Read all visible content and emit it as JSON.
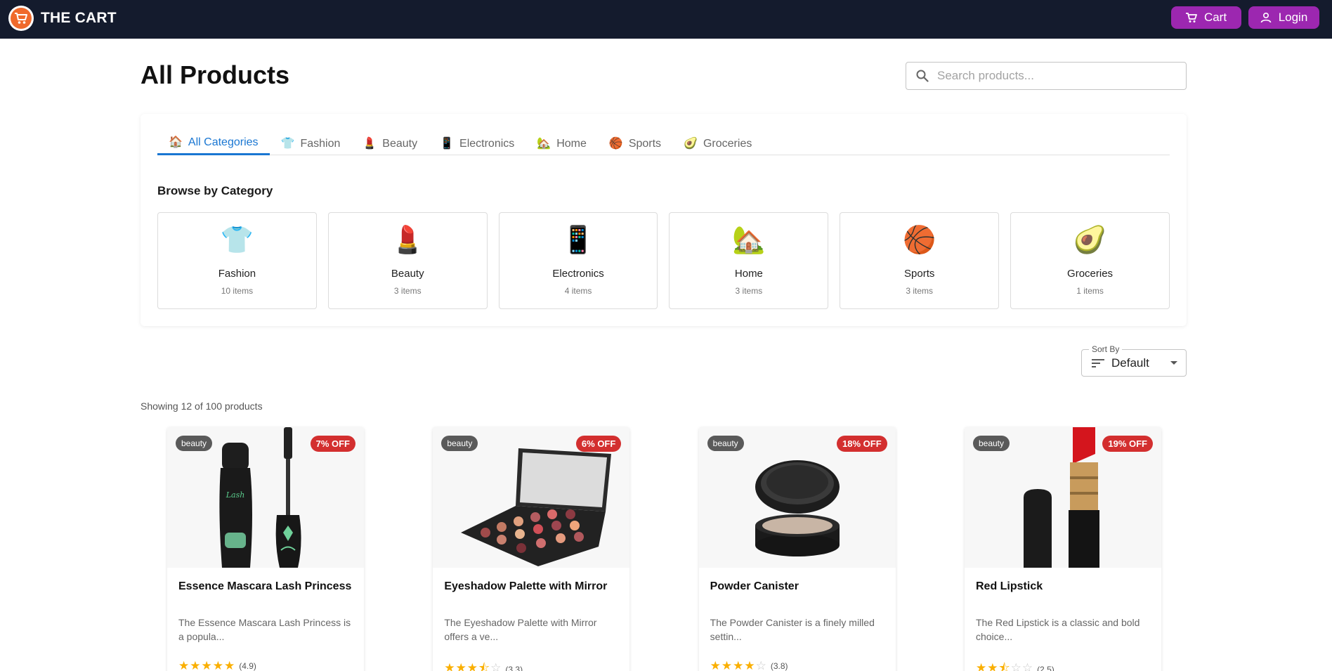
{
  "header": {
    "brand": "THE CART",
    "cart_label": "Cart",
    "login_label": "Login"
  },
  "page": {
    "title": "All Products",
    "search_placeholder": "Search products..."
  },
  "tabs": [
    {
      "icon": "🏠",
      "label": "All Categories"
    },
    {
      "icon": "👕",
      "label": "Fashion"
    },
    {
      "icon": "💄",
      "label": "Beauty"
    },
    {
      "icon": "📱",
      "label": "Electronics"
    },
    {
      "icon": "🏡",
      "label": "Home"
    },
    {
      "icon": "🏀",
      "label": "Sports"
    },
    {
      "icon": "🥑",
      "label": "Groceries"
    }
  ],
  "browse": {
    "title": "Browse by Category",
    "categories": [
      {
        "icon": "👕",
        "name": "Fashion",
        "count": "10 items"
      },
      {
        "icon": "💄",
        "name": "Beauty",
        "count": "3 items"
      },
      {
        "icon": "📱",
        "name": "Electronics",
        "count": "4 items"
      },
      {
        "icon": "🏡",
        "name": "Home",
        "count": "3 items"
      },
      {
        "icon": "🏀",
        "name": "Sports",
        "count": "3 items"
      },
      {
        "icon": "🥑",
        "name": "Groceries",
        "count": "1 items"
      }
    ]
  },
  "sort": {
    "label": "Sort By",
    "value": "Default"
  },
  "showing_text": "Showing 12 of 100 products",
  "products": [
    {
      "category": "beauty",
      "discount": "7% OFF",
      "name": "Essence Mascara Lash Princess",
      "description": "The Essence Mascara Lash Princess is a popula...",
      "rating": 4.9,
      "rating_text": "(4.9)",
      "image_icon": "mascara-image"
    },
    {
      "category": "beauty",
      "discount": "6% OFF",
      "name": "Eyeshadow Palette with Mirror",
      "description": "The Eyeshadow Palette with Mirror offers a ve...",
      "rating": 3.3,
      "rating_text": "(3.3)",
      "image_icon": "eyeshadow-palette-image"
    },
    {
      "category": "beauty",
      "discount": "18% OFF",
      "name": "Powder Canister",
      "description": "The Powder Canister is a finely milled settin...",
      "rating": 3.8,
      "rating_text": "(3.8)",
      "image_icon": "powder-canister-image"
    },
    {
      "category": "beauty",
      "discount": "19% OFF",
      "name": "Red Lipstick",
      "description": "The Red Lipstick is a classic and bold choice...",
      "rating": 2.5,
      "rating_text": "(2.5)",
      "image_icon": "red-lipstick-image"
    }
  ],
  "colors": {
    "header_bg": "#141b2d",
    "accent_purple": "#9c27b0",
    "tab_active": "#1976d2",
    "discount_red": "#d32f2f",
    "star_gold": "#faaf00"
  }
}
